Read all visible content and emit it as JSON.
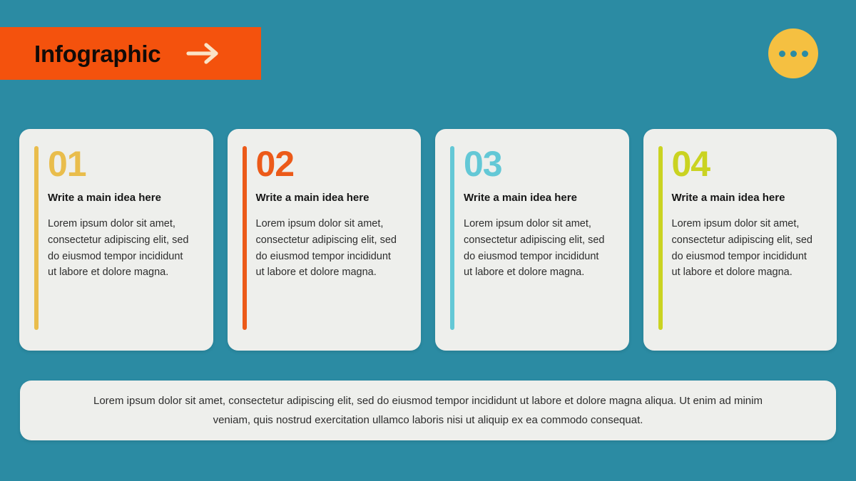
{
  "theme": {
    "background": "#2b8ba3",
    "banner": "#f4520d",
    "card_surface": "#eeefec",
    "accent_circle": "#f5c041",
    "arrow": "#fae3c6"
  },
  "header": {
    "title": "Infographic",
    "arrow_icon": "arrow-right-icon",
    "menu_icon": "ellipsis-icon",
    "menu_dots": [
      "dot",
      "dot",
      "dot"
    ]
  },
  "cards": [
    {
      "number": "01",
      "heading": "Write a main idea here",
      "body": "Lorem ipsum dolor sit amet, consectetur adipiscing elit, sed do eiusmod tempor incididunt ut labore et dolore magna.",
      "accent_color": "#e9bd4c"
    },
    {
      "number": "02",
      "heading": "Write a main idea here",
      "body": "Lorem ipsum dolor sit amet, consectetur adipiscing elit, sed do eiusmod tempor incididunt ut labore et dolore magna.",
      "accent_color": "#ec5a19"
    },
    {
      "number": "03",
      "heading": "Write a main idea here",
      "body": "Lorem ipsum dolor sit amet, consectetur adipiscing elit, sed do eiusmod tempor incididunt ut labore et dolore magna.",
      "accent_color": "#63c8d6"
    },
    {
      "number": "04",
      "heading": "Write a main idea here",
      "body": "Lorem ipsum dolor sit amet, consectetur adipiscing elit, sed do eiusmod tempor incididunt ut labore et dolore magna.",
      "accent_color": "#cad321"
    }
  ],
  "caption": {
    "text": "Lorem ipsum dolor sit amet, consectetur adipiscing elit, sed do eiusmod tempor incididunt ut labore et dolore magna aliqua. Ut enim ad minim veniam, quis nostrud exercitation ullamco laboris nisi ut aliquip ex ea commodo consequat."
  }
}
